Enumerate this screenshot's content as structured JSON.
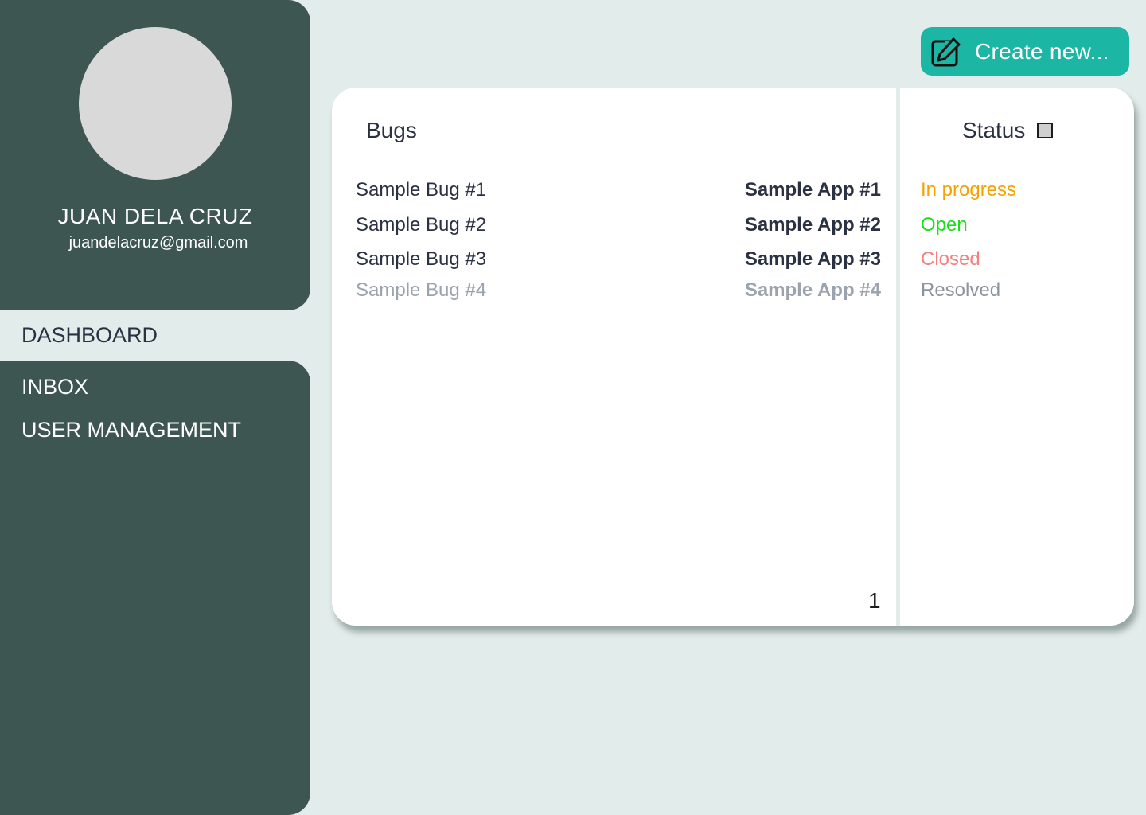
{
  "user": {
    "name": "JUAN DELA CRUZ",
    "email": "juandelacruz@gmail.com"
  },
  "nav": {
    "dashboard": "DASHBOARD",
    "inbox": "INBOX",
    "user_management": "USER MANAGEMENT"
  },
  "toolbar": {
    "create_label": "Create new...",
    "create_icon": "edit-icon"
  },
  "table": {
    "bugs_header": "Bugs",
    "status_header": "Status",
    "rows": [
      {
        "bug": "Sample Bug #1",
        "app": "Sample App #1",
        "status": "In progress",
        "status_color": "#f5a300"
      },
      {
        "bug": "Sample Bug #2",
        "app": "Sample App #2",
        "status": "Open",
        "status_color": "#16e01a"
      },
      {
        "bug": "Sample Bug #3",
        "app": "Sample App #3",
        "status": "Closed",
        "status_color": "#f57f7f"
      },
      {
        "bug": "Sample Bug #4",
        "app": "Sample App #4",
        "status": "Resolved",
        "status_color": "#8c949f"
      }
    ],
    "page": "1"
  },
  "colors": {
    "sidebar": "#3d5652",
    "background": "#e2ecea",
    "accent": "#1cb6a5"
  }
}
